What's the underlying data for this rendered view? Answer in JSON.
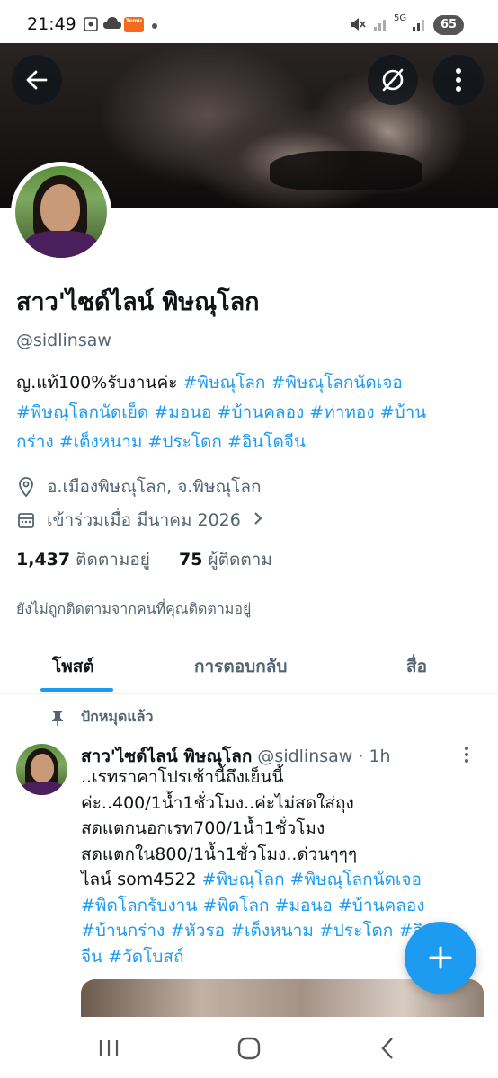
{
  "status_bar": {
    "time": "21:49",
    "temu_label": "Temu",
    "network": "5G",
    "battery": "65"
  },
  "profile": {
    "display_name": "สาว'ไซด์ไลน์ พิษณุโลก",
    "handle": "@sidlinsaw",
    "bio_line1_text": "ญ.แท้100%รับงานค่ะ ",
    "bio_line1_tags": "#พิษณุโลก #พิษณุโลกนัดเจอ",
    "bio_line2_tags": "#พิษณุโลกนัดเย็ด #มอนอ #บ้านคลอง #ท่าทอง #บ้าน",
    "bio_line3_tags": "กร่าง #เต็งหนาม #ประโดก #อินโดจีน",
    "location": "อ.เมืองพิษณุโลก, จ.พิษณุโลก",
    "joined": "เข้าร่วมเมื่อ มีนาคม 2026",
    "following_count": "1,437",
    "following_label": "ติดตามอยู่",
    "followers_count": "75",
    "followers_label": "ผู้ติดตาม",
    "not_followed_note": "ยังไม่ถูกติดตามจากคนที่คุณติดตามอยู่"
  },
  "tabs": [
    {
      "label": "โพสต์"
    },
    {
      "label": "การตอบกลับ"
    },
    {
      "label": "สื่อ"
    }
  ],
  "pinned_label": "ปักหมุดแล้ว",
  "tweet": {
    "name": "สาว'ไซด์ไลน์ พิษณุโลก",
    "handle_time": " @sidlinsaw · 1h",
    "line1": "..เรทราคาโปรเช้านี้ถึงเย็นนี้",
    "line2": "ค่ะ..400/1น้ำ1ชั่วโมง..ค่ะไม่สดใส่ถุง",
    "line3": "สดแตกนอกเรท700/1น้ำ1ชั่วโมง",
    "line4": "สดแตกใน800/1น้ำ1ชั่วโมง..ด่วนๆๆๆ",
    "line5_text": "ไลน์ som4522 ",
    "line5_tags": "#พิษณุโลก #พิษณุโลกนัดเจอ",
    "line6_tags": "#พิดโลกรับงาน #พิดโลก  #มอนอ #บ้านคลอง",
    "line7_tags": "#บ้านกร่าง #หัวรอ #เต็งหนาม #ประโดก #อิน",
    "line8_tags": "จีน #วัดโบสถ์"
  },
  "colors": {
    "accent": "#1d9bf0",
    "text_primary": "#0f1419",
    "text_secondary": "#536471"
  },
  "icons": {
    "back": "arrow-left-icon",
    "unmute": "slashed-circle-icon",
    "more": "more-vertical-icon",
    "location": "location-pin-icon",
    "calendar": "calendar-icon",
    "pin": "pin-icon",
    "compose": "plus-icon"
  }
}
